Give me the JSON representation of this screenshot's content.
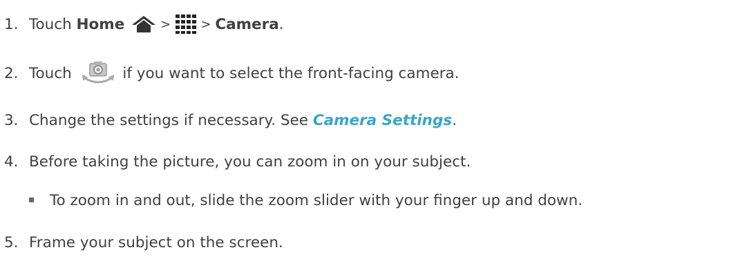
{
  "steps": [
    {
      "num": "1.",
      "parts": {
        "touch": "Touch ",
        "home": "Home",
        "sep1": " > ",
        "sep2": " > ",
        "camera": "Camera",
        "end": "."
      },
      "icons": [
        "home-icon",
        "all-apps-grid-icon"
      ]
    },
    {
      "num": "2.",
      "parts": {
        "touch": "Touch ",
        "rest": " if you want to select the front-facing camera."
      },
      "icons": [
        "switch-camera-icon"
      ]
    },
    {
      "num": "3.",
      "parts": {
        "text": "Change the settings if necessary. See ",
        "link": "Camera Settings",
        "end": "."
      }
    },
    {
      "num": "4.",
      "parts": {
        "text": "Before taking the picture, you can zoom in on your subject."
      },
      "bullet": "To zoom in and out, slide the zoom slider with your finger up and down."
    },
    {
      "num": "5.",
      "parts": {
        "text": "Frame your subject on the screen."
      }
    }
  ],
  "colors": {
    "text": "#404040",
    "link": "#3aa5c6",
    "bullet": "#666666"
  }
}
